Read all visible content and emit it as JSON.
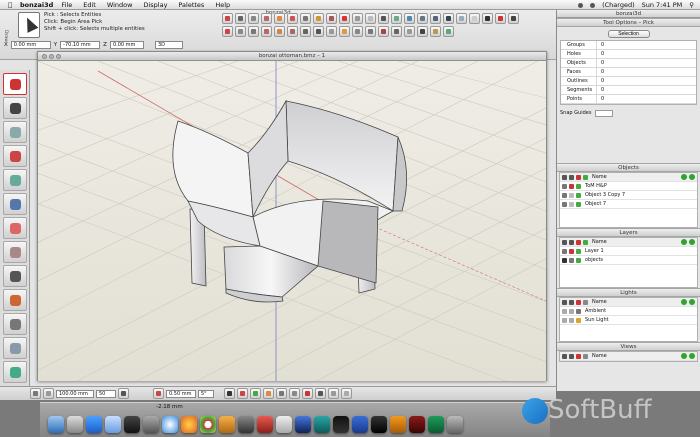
{
  "menubar": {
    "app": "bonzai3d",
    "items": [
      "File",
      "Edit",
      "Window",
      "Display",
      "Palettes",
      "Help"
    ],
    "battery": "(Charged)",
    "clock": "Sun 7:41 PM"
  },
  "window": {
    "title": "bonzai3d"
  },
  "tool": {
    "hint1": "Pick : Selects Entities",
    "hint2": "Click: Begin Area Pick",
    "hint3": "Shift + click: Selects multiple entities"
  },
  "coords": {
    "x_label": "X",
    "x": "0.00 mm",
    "y_label": "Y",
    "y": "-70.10 mm",
    "z_label": "Z",
    "z": "0.00 mm",
    "mode": "3D"
  },
  "left_side_label": "Draw",
  "document": {
    "title": "bonzai ottoman.bmz – 1"
  },
  "right_panel": {
    "title": "Tool Options – Pick",
    "selection_button": "Selection",
    "stats": [
      {
        "label": "Groups",
        "value": "0"
      },
      {
        "label": "Holes",
        "value": "0"
      },
      {
        "label": "Objects",
        "value": "0"
      },
      {
        "label": "Faces",
        "value": "0"
      },
      {
        "label": "Outlines",
        "value": "0"
      },
      {
        "label": "Segments",
        "value": "0"
      },
      {
        "label": "Points",
        "value": "0"
      }
    ],
    "snap_label": "Snap Guides",
    "objects": {
      "title": "Objects",
      "header": "Name",
      "rows": [
        "ToM H&P",
        "Object 3 Copy 7",
        "Object 7"
      ]
    },
    "layers": {
      "title": "Layers",
      "header": "Name",
      "rows": [
        "Layer 1",
        "objects"
      ]
    },
    "lights": {
      "title": "Lights",
      "header": "Name",
      "rows": [
        "Ambient",
        "Sun Light"
      ]
    },
    "views": {
      "title": "Views",
      "header": "Name"
    }
  },
  "bottombar": {
    "field1": "100.00 mm",
    "field2": "50",
    "field3": "0.50 mm",
    "field4": "5°"
  },
  "coord_tip": "-2.18 mm",
  "watermark": "SoftBuff",
  "colors": {
    "grid_bg": "#e7e5da",
    "grid_line": "#cfcdbf",
    "model": "#e9e9ea",
    "accent_red": "#cc3333",
    "ok_green": "#2fa52f"
  }
}
